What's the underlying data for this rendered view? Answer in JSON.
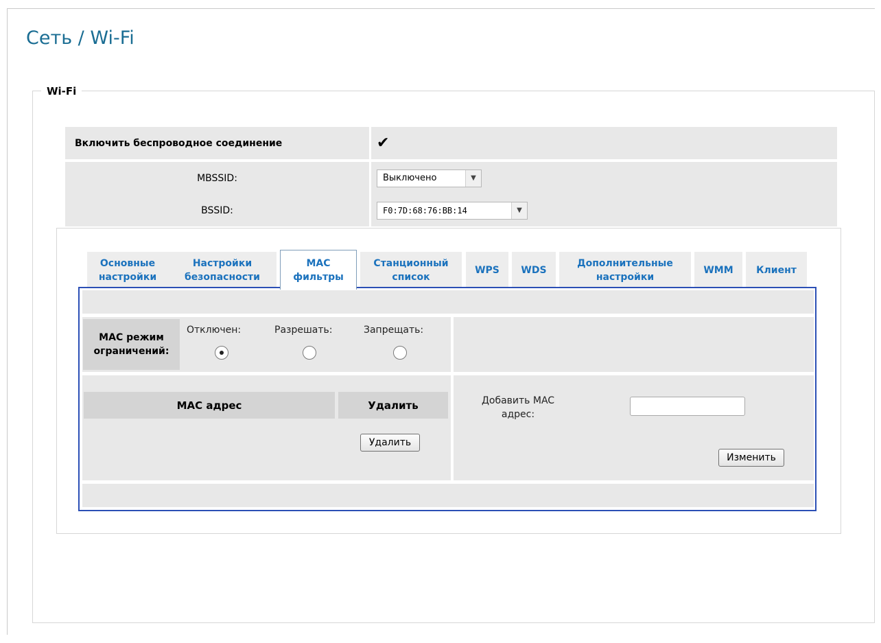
{
  "page": {
    "title": "Сеть / Wi-Fi"
  },
  "group": {
    "legend": "Wi-Fi"
  },
  "settings": {
    "enable_label": "Включить беспроводное соединение",
    "enable_checked": true,
    "mbssid_label": "MBSSID:",
    "mbssid_value": "Выключено",
    "bssid_label": "BSSID:",
    "bssid_value": "F0:7D:68:76:BB:14"
  },
  "tabs": [
    {
      "line1": "Основные",
      "line2": "настройки",
      "active": false
    },
    {
      "line1": "Настройки",
      "line2": "безопасности",
      "active": false
    },
    {
      "line1": "MAC",
      "line2": "фильтры",
      "active": true
    },
    {
      "line1": "Станционный",
      "line2": "список",
      "active": false
    },
    {
      "line1": "WPS",
      "line2": "",
      "active": false
    },
    {
      "line1": "WDS",
      "line2": "",
      "active": false
    },
    {
      "line1": "Дополнительные",
      "line2": "настройки",
      "active": false
    },
    {
      "line1": "WMM",
      "line2": "",
      "active": false
    },
    {
      "line1": "Клиент",
      "line2": "",
      "active": false
    }
  ],
  "mac_filter": {
    "mode_label_line1": "MAC режим",
    "mode_label_line2": "ограничений:",
    "options": [
      {
        "label": "Отключен:",
        "selected": true
      },
      {
        "label": "Разрешать:",
        "selected": false
      },
      {
        "label": "Запрещать:",
        "selected": false
      }
    ],
    "table_headers": {
      "mac": "MAC адрес",
      "delete": "Удалить"
    },
    "delete_button": "Удалить",
    "add_label_line1": "Добавить MAC",
    "add_label_line2": "адрес:",
    "add_input_value": "",
    "change_button": "Изменить"
  }
}
